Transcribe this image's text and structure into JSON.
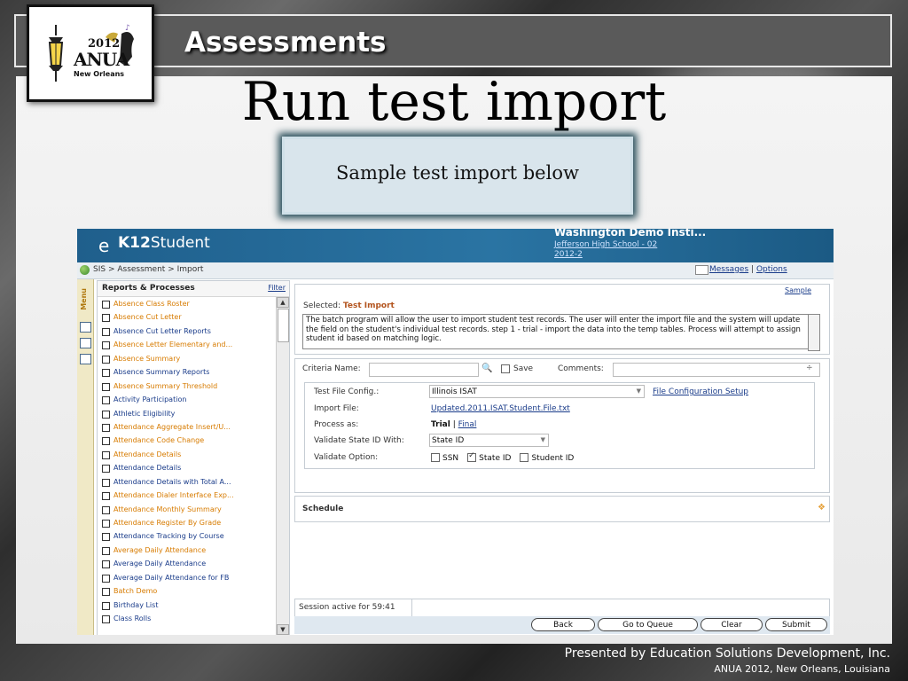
{
  "slide": {
    "section_title": "Assessments",
    "heading": "Run test import",
    "callout": "Sample test import below",
    "footer_line1": "Presented by Education Solutions Development, Inc.",
    "footer_line2": "ANUA 2012, New Orleans, Louisiana",
    "logo": {
      "year": "2012",
      "name": "ANUA",
      "city": "New Orleans"
    }
  },
  "app": {
    "logo_prefix": "e",
    "logo_name_bold": "K12",
    "logo_name": "Student",
    "institution": "Washington Demo Insti...",
    "school": "Jefferson High School - 02",
    "year": "2012-2",
    "breadcrumb": "SIS > Assessment > Import",
    "messages_link": "Messages",
    "options_link": "Options",
    "menu_tab": "Menu",
    "reports": {
      "title": "Reports & Processes",
      "filter": "Filter",
      "items": [
        {
          "label": "Absence Class Roster",
          "color": "#d77b00"
        },
        {
          "label": "Absence Cut Letter",
          "color": "#d77b00"
        },
        {
          "label": "Absence Cut Letter Reports",
          "color": "#1a3c8a"
        },
        {
          "label": "Absence Letter Elementary and...",
          "color": "#d77b00"
        },
        {
          "label": "Absence Summary",
          "color": "#d77b00"
        },
        {
          "label": "Absence Summary Reports",
          "color": "#1a3c8a"
        },
        {
          "label": "Absence Summary Threshold",
          "color": "#d77b00"
        },
        {
          "label": "Activity Participation",
          "color": "#1a3c8a"
        },
        {
          "label": "Athletic Eligibility",
          "color": "#1a3c8a"
        },
        {
          "label": "Attendance Aggregate Insert/U...",
          "color": "#d77b00"
        },
        {
          "label": "Attendance Code Change",
          "color": "#d77b00"
        },
        {
          "label": "Attendance Details",
          "color": "#d77b00"
        },
        {
          "label": "Attendance Details",
          "color": "#1a3c8a"
        },
        {
          "label": "Attendance Details with Total A...",
          "color": "#1a3c8a"
        },
        {
          "label": "Attendance Dialer Interface Exp...",
          "color": "#d77b00"
        },
        {
          "label": "Attendance Monthly Summary",
          "color": "#d77b00"
        },
        {
          "label": "Attendance Register By Grade",
          "color": "#d77b00"
        },
        {
          "label": "Attendance Tracking by Course",
          "color": "#1a3c8a"
        },
        {
          "label": "Average Daily Attendance",
          "color": "#d77b00"
        },
        {
          "label": "Average Daily Attendance",
          "color": "#1a3c8a"
        },
        {
          "label": "Average Daily Attendance for FB",
          "color": "#1a3c8a"
        },
        {
          "label": "Batch Demo",
          "color": "#d77b00"
        },
        {
          "label": "Birthday List",
          "color": "#1a3c8a"
        },
        {
          "label": "Class Rolls",
          "color": "#1a3c8a"
        }
      ]
    },
    "selected": {
      "sample_link": "Sample",
      "label": "Selected:",
      "value": "Test Import",
      "description": "The batch program will allow the user to import student test records. The user will enter the import file and the system will update the field on the student's individual test records.\nstep 1 -  trial -  import the data into the temp tables. Process will attempt to assign student id based on matching logic."
    },
    "criteria": {
      "name_label": "Criteria Name:",
      "save_label": "Save",
      "comments_label": "Comments:",
      "test_file_config_label": "Test File Config.:",
      "test_file_config_value": "Illinois ISAT",
      "file_config_setup_link": "File Configuration Setup",
      "import_file_label": "Import File:",
      "import_file_value": "Updated.2011.ISAT.Student.File.txt",
      "process_as_label": "Process as:",
      "process_trial": "Trial",
      "process_sep": "|",
      "process_final": "Final",
      "validate_state_label": "Validate State ID With:",
      "validate_state_value": "State ID",
      "validate_option_label": "Validate Option:",
      "options": [
        {
          "label": "SSN",
          "checked": false
        },
        {
          "label": "State ID",
          "checked": true
        },
        {
          "label": "Student ID",
          "checked": false
        }
      ]
    },
    "schedule_label": "Schedule",
    "session": "Session active for 59:41",
    "buttons": {
      "back": "Back",
      "queue": "Go to Queue",
      "clear": "Clear",
      "submit": "Submit"
    }
  }
}
